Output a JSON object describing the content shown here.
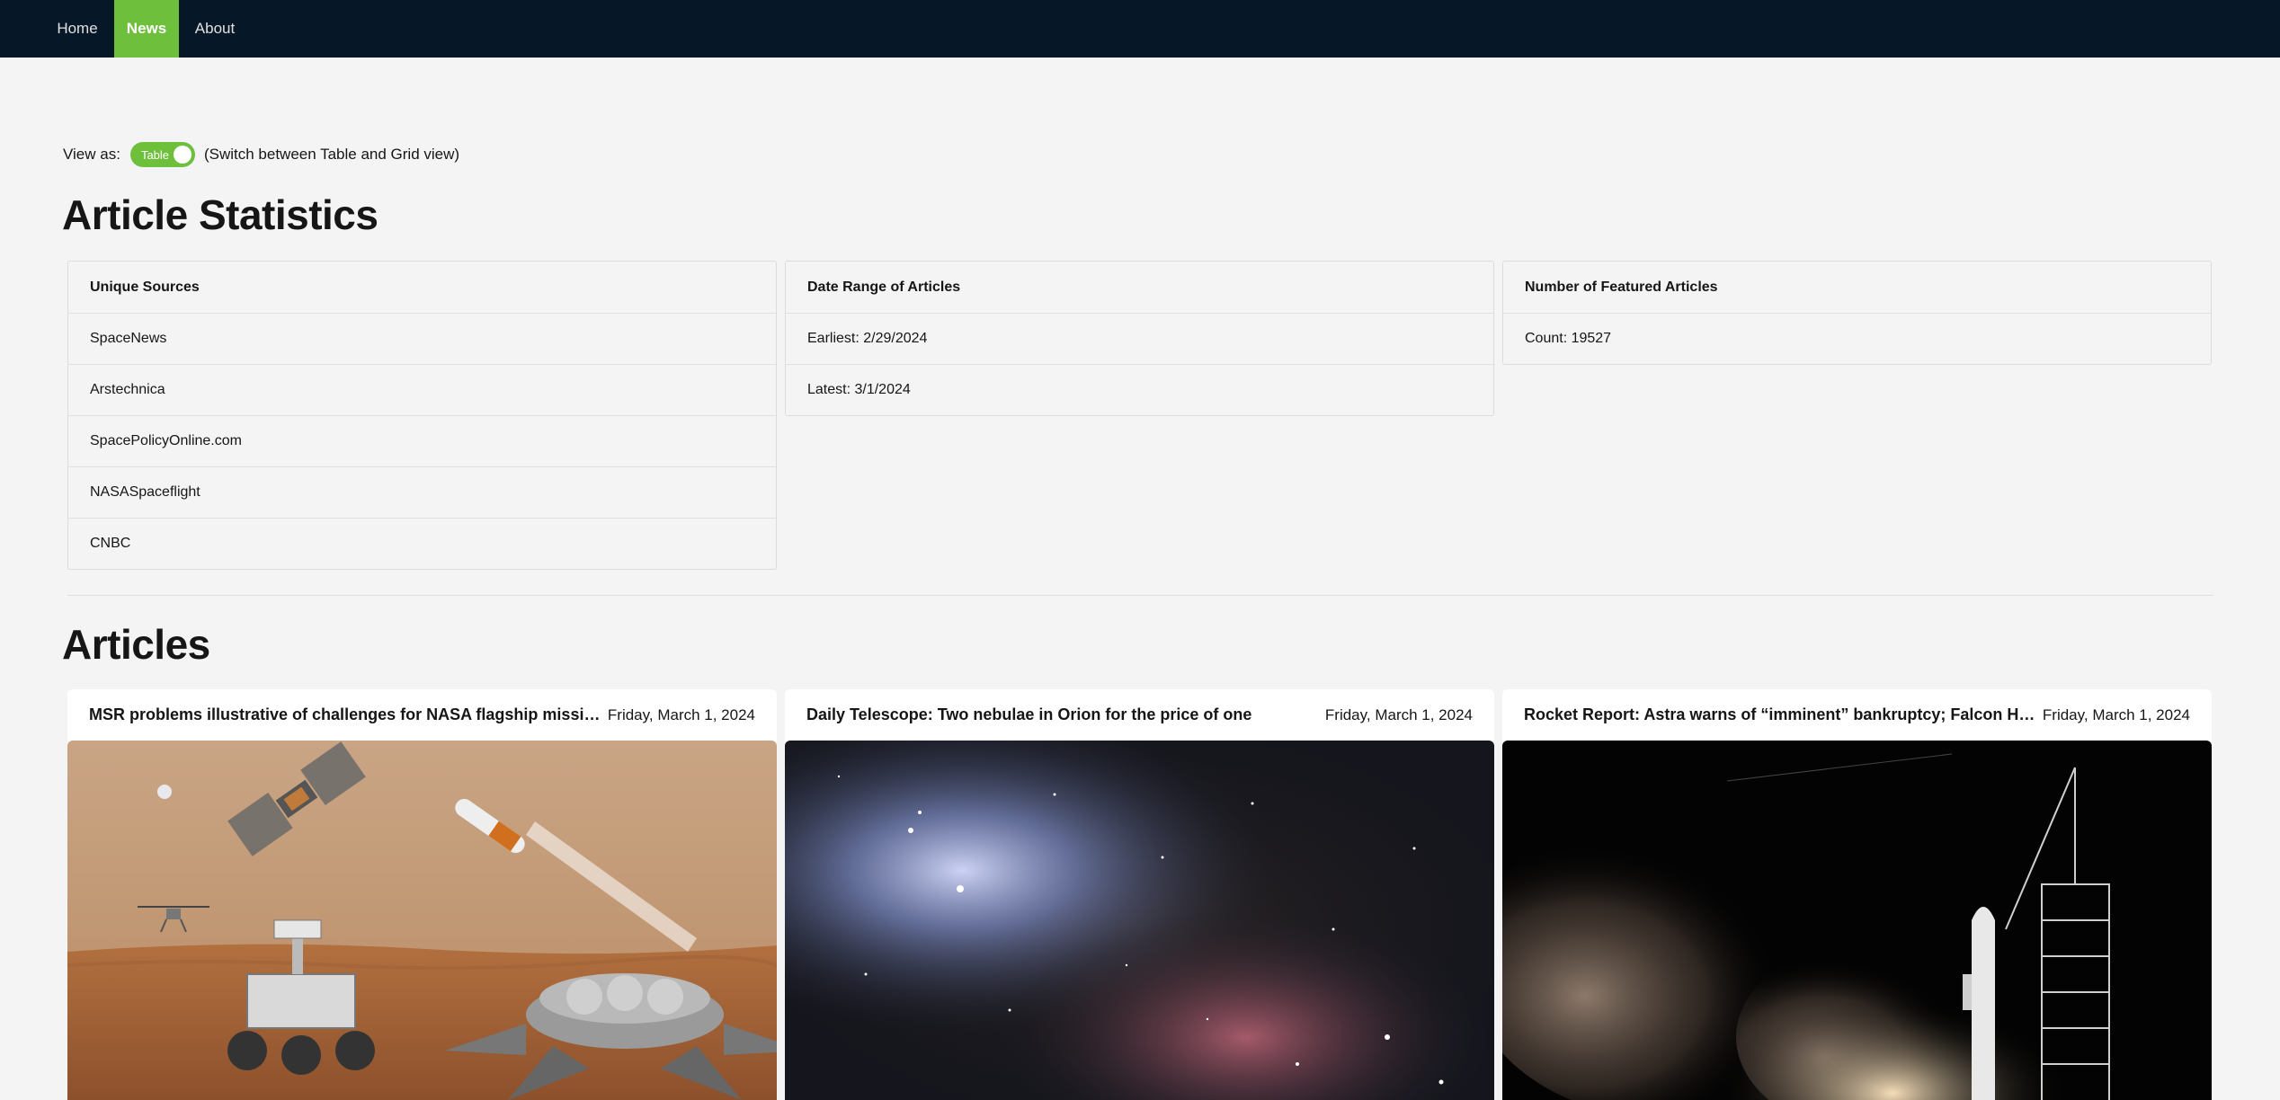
{
  "nav": {
    "items": [
      {
        "label": "Home",
        "active": false
      },
      {
        "label": "News",
        "active": true
      },
      {
        "label": "About",
        "active": false
      }
    ]
  },
  "view": {
    "label": "View as:",
    "toggle_label": "Table",
    "toggle_on": true,
    "hint": "(Switch between Table and Grid view)"
  },
  "stats": {
    "title": "Article Statistics",
    "sources": {
      "header": "Unique Sources",
      "items": [
        "SpaceNews",
        "Arstechnica",
        "SpacePolicyOnline.com",
        "NASASpaceflight",
        "CNBC"
      ]
    },
    "date_range": {
      "header": "Date Range of Articles",
      "earliest": "Earliest: 2/29/2024",
      "latest": "Latest: 3/1/2024"
    },
    "featured": {
      "header": "Number of Featured Articles",
      "count": "Count: 19527"
    }
  },
  "articles": {
    "title": "Articles",
    "items": [
      {
        "title": "MSR problems illustrative of challenges for NASA flagship missions,...",
        "date": "Friday, March 1, 2024",
        "image": "mars-sample-return-illustration"
      },
      {
        "title": "Daily Telescope: Two nebulae in Orion for the price of one",
        "date": "Friday, March 1, 2024",
        "image": "orion-nebula-photo"
      },
      {
        "title": "Rocket Report: Astra warns of “imminent” bankruptcy; Falcon Heav...",
        "date": "Friday, March 1, 2024",
        "image": "rocket-launch-photo"
      }
    ]
  },
  "colors": {
    "nav_bg": "#061727",
    "accent": "#6ebf3b",
    "page_bg": "#f4f4f4"
  }
}
